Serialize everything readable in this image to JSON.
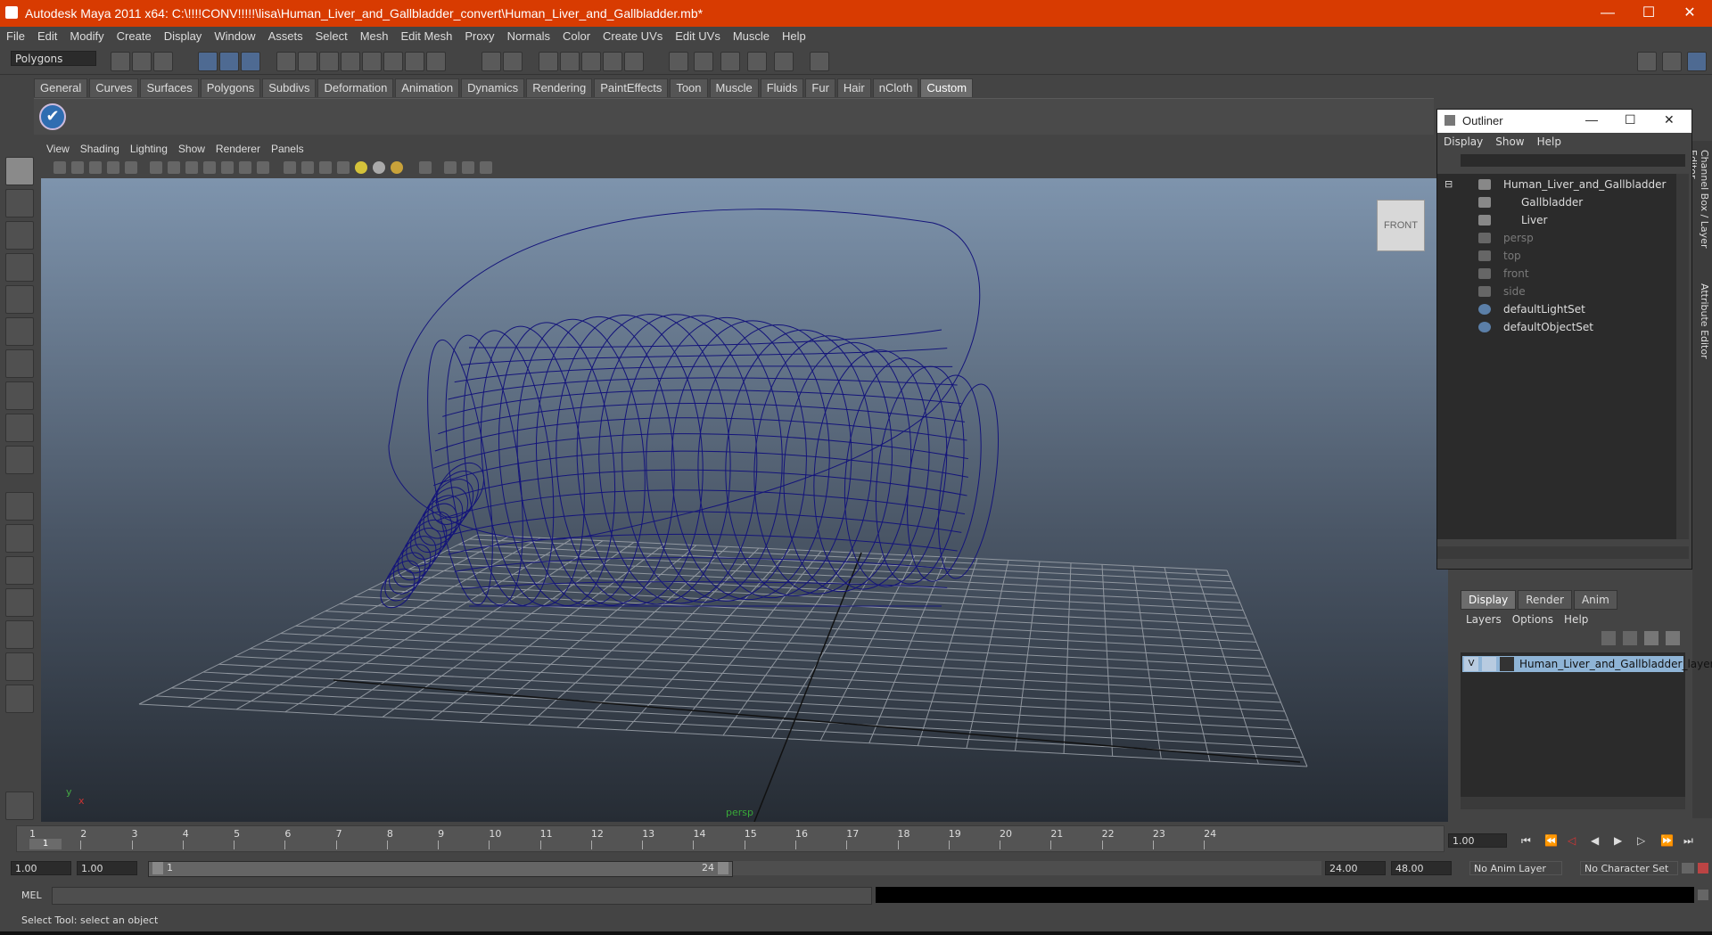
{
  "window": {
    "title": "Autodesk Maya 2011 x64: C:\\!!!!CONV!!!!!\\lisa\\Human_Liver_and_Gallbladder_convert\\Human_Liver_and_Gallbladder.mb*",
    "minimize": "—",
    "maximize": "☐",
    "close": "✕"
  },
  "menubar": [
    "File",
    "Edit",
    "Modify",
    "Create",
    "Display",
    "Window",
    "Assets",
    "Select",
    "Mesh",
    "Edit Mesh",
    "Proxy",
    "Normals",
    "Color",
    "Create UVs",
    "Edit UVs",
    "Muscle",
    "Help"
  ],
  "statusline": {
    "mode": "Polygons"
  },
  "shelf": {
    "tabs": [
      "General",
      "Curves",
      "Surfaces",
      "Polygons",
      "Subdivs",
      "Deformation",
      "Animation",
      "Dynamics",
      "Rendering",
      "PaintEffects",
      "Toon",
      "Muscle",
      "Fluids",
      "Fur",
      "Hair",
      "nCloth",
      "Custom"
    ],
    "active_tab": "Custom"
  },
  "viewport": {
    "menus": [
      "View",
      "Shading",
      "Lighting",
      "Show",
      "Renderer",
      "Panels"
    ],
    "viewcube_label": "FRONT",
    "camera_label": "persp",
    "axis_y": "y",
    "axis_x": "x",
    "wire_color": "#14147a"
  },
  "outliner": {
    "title": "Outliner",
    "menus": [
      "Display",
      "Show",
      "Help"
    ],
    "items": [
      {
        "label": "Human_Liver_and_Gallbladder",
        "dim": false
      },
      {
        "label": "Gallbladder",
        "dim": false
      },
      {
        "label": "Liver",
        "dim": false
      },
      {
        "label": "persp",
        "dim": true
      },
      {
        "label": "top",
        "dim": true
      },
      {
        "label": "front",
        "dim": true
      },
      {
        "label": "side",
        "dim": true
      },
      {
        "label": "defaultLightSet",
        "dim": false
      },
      {
        "label": "defaultObjectSet",
        "dim": false
      }
    ]
  },
  "right_tabs": {
    "channel_box": "Channel Box / Layer Editor",
    "attribute_editor": "Attribute Editor"
  },
  "layer_editor": {
    "tabs": [
      "Display",
      "Render",
      "Anim"
    ],
    "active_tab": "Display",
    "menus": [
      "Layers",
      "Options",
      "Help"
    ],
    "layer": {
      "visible": "V",
      "name": "Human_Liver_and_Gallbladder_layer"
    }
  },
  "timeline": {
    "ticks": [
      "1",
      "2",
      "3",
      "4",
      "5",
      "6",
      "7",
      "8",
      "9",
      "10",
      "11",
      "12",
      "13",
      "14",
      "15",
      "16",
      "17",
      "18",
      "19",
      "20",
      "21",
      "22",
      "23",
      "24"
    ],
    "current_frame": "1",
    "current_time_field": "1.00"
  },
  "range": {
    "start_time": "1.00",
    "playback_start": "1.00",
    "slider_start": "1",
    "slider_end": "24",
    "playback_end": "24.00",
    "end_time": "48.00",
    "anim_layer": "No Anim Layer",
    "character_set": "No Character Set"
  },
  "command_line": {
    "label": "MEL"
  },
  "help_line": {
    "text": "Select Tool: select an object"
  }
}
